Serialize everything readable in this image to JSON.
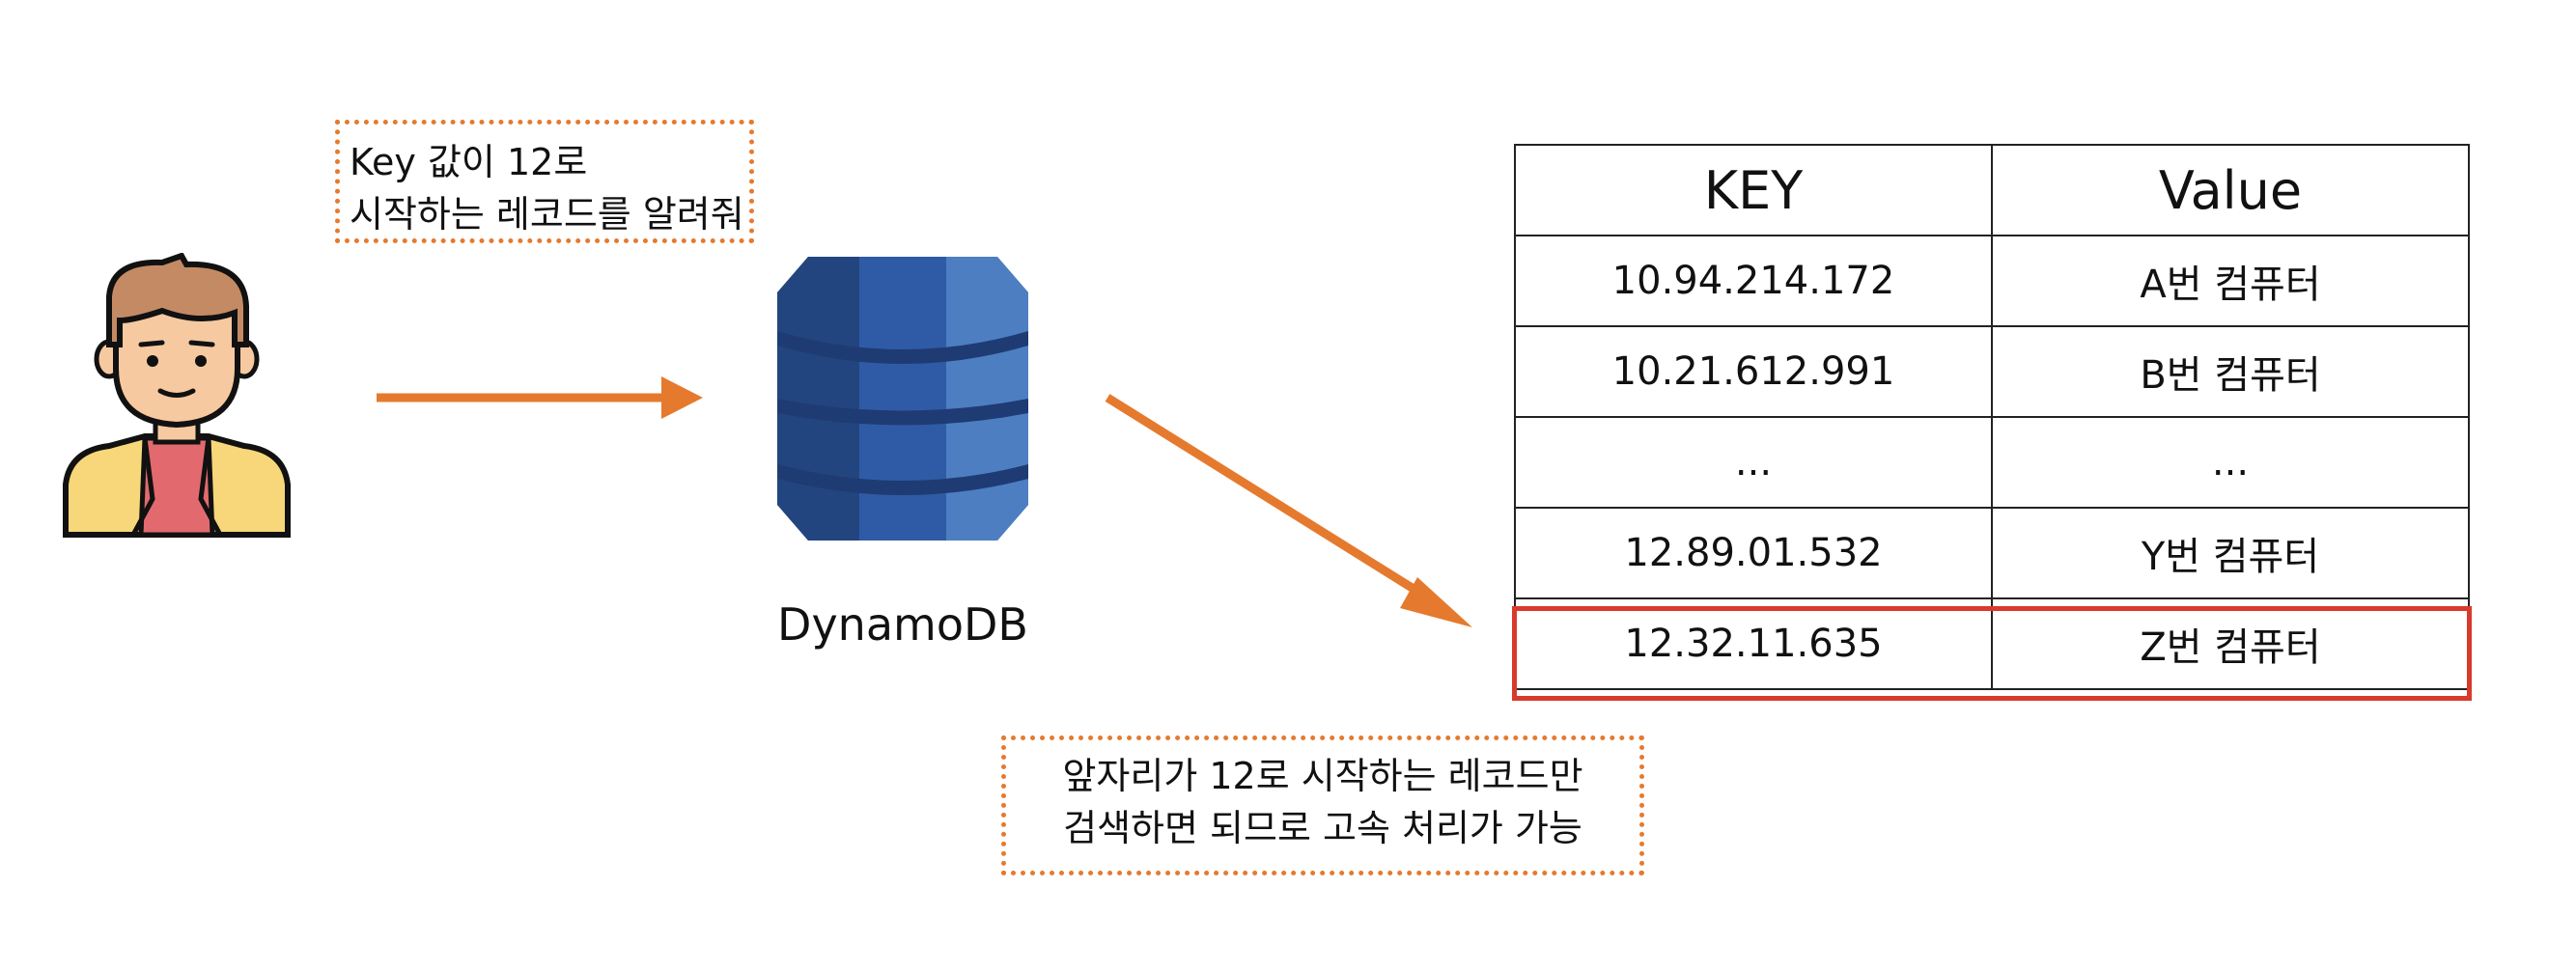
{
  "query_note": {
    "lines": [
      "Key  값이 12로",
      "시작하는 레코드를 알려줘"
    ]
  },
  "db": {
    "label": "DynamoDB"
  },
  "table": {
    "headers": [
      "KEY",
      "Value"
    ],
    "rows": [
      [
        "10.94.214.172",
        "A번 컴퓨터"
      ],
      [
        "10.21.612.991",
        "B번 컴퓨터"
      ],
      [
        "...",
        "..."
      ],
      [
        "12.89.01.532",
        "Y번 컴퓨터"
      ],
      [
        "12.32.11.635",
        "Z번 컴퓨터"
      ]
    ]
  },
  "result_note": {
    "lines": [
      "앞자리가 12로 시작하는 레코드만",
      "검색하면 되므로 고속 처리가 가능"
    ]
  },
  "colors": {
    "arrow": "#e57a2e",
    "highlight": "#d93a2b",
    "db_dark": "#1f3b73",
    "db_mid": "#2f5ba6",
    "db_light": "#4d7ec2"
  },
  "icons": {
    "person": "person-icon",
    "database": "dynamodb-icon"
  }
}
